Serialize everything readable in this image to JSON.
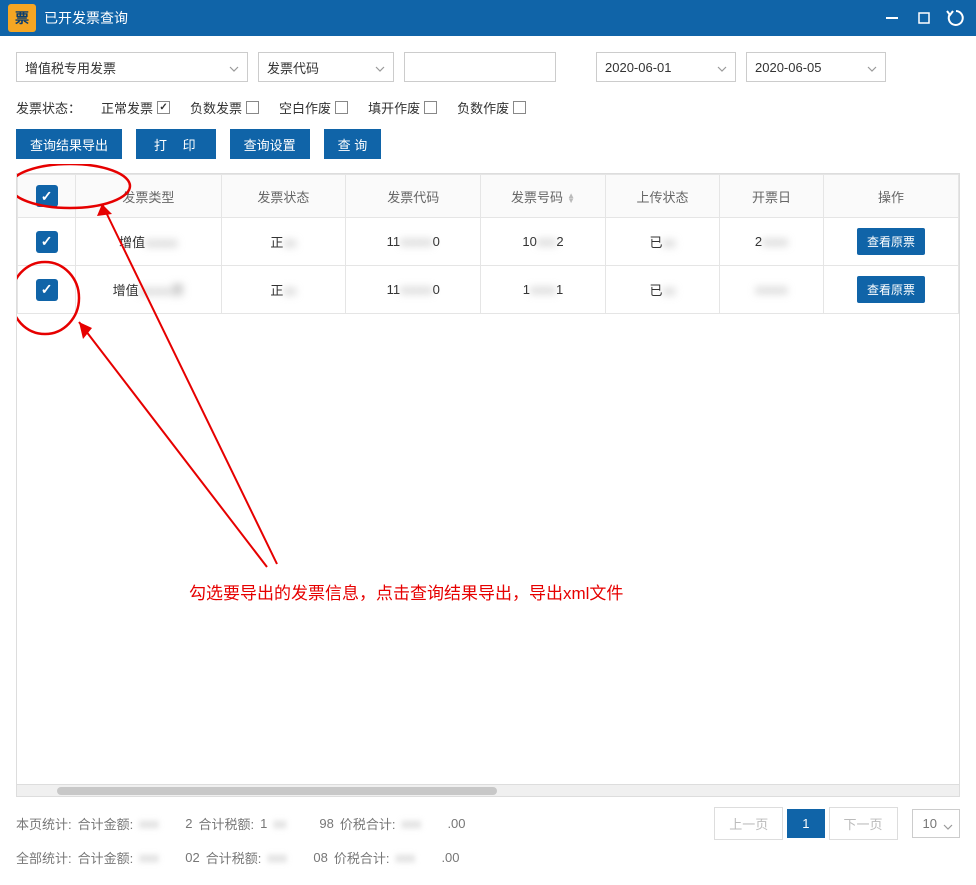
{
  "titlebar": {
    "logo": "票",
    "title": "已开发票查询"
  },
  "filters": {
    "invoice_type": "增值税专用发票",
    "code_field_label": "发票代码",
    "code_value": "",
    "date_from": "2020-06-01",
    "date_to": "2020-06-05"
  },
  "status": {
    "label": "发票状态：",
    "options": {
      "normal": "正常发票",
      "negative": "负数发票",
      "blank_void": "空白作废",
      "fill_void": "填开作废",
      "neg_void": "负数作废"
    }
  },
  "buttons": {
    "export": "查询结果导出",
    "print": "打 印",
    "settings": "查询设置",
    "query": "查  询"
  },
  "table": {
    "headers": {
      "type": "发票类型",
      "status": "发票状态",
      "code": "发票代码",
      "number": "发票号码",
      "upload": "上传状态",
      "date": "开票日",
      "action": "操作"
    },
    "rows": [
      {
        "type_prefix": "增值",
        "type_blur": "xxxxx",
        "status_prefix": "正",
        "status_blur": "xx",
        "code_prefix": "11",
        "code_blur": "xxxxx",
        "code_suffix": "0",
        "num_prefix": "10",
        "num_blur": "xxx",
        "num_suffix": "2",
        "upload_prefix": "已",
        "upload_blur": "xx",
        "date_prefix": "2",
        "date_blur": "xxxx",
        "action": "查看原票"
      },
      {
        "type_prefix": "增值",
        "type_blur": "xxxxx票",
        "status_prefix": "正",
        "status_blur": "xx",
        "code_prefix": "11",
        "code_blur": "xxxxx",
        "code_suffix": "0",
        "num_prefix": "1",
        "num_blur": "xxxx",
        "num_suffix": "1",
        "upload_prefix": "已",
        "upload_blur": "xx",
        "date_prefix": "",
        "date_blur": "xxxxx",
        "action": "查看原票"
      }
    ]
  },
  "annotation": {
    "text": "勾选要导出的发票信息，点击查询结果导出，导出xml文件"
  },
  "footer": {
    "page_stats": {
      "label": "本页统计:",
      "amount_label": "合计金额:",
      "amount_blur": "xxx",
      "amount_suffix": "2",
      "tax_label": "合计税额:",
      "tax_prefix": "1",
      "tax_blur": "xx",
      "tax_suffix": "98",
      "total_label": "价税合计:",
      "total_blur": "xxx",
      "total_suffix": ".00"
    },
    "all_stats": {
      "label": "全部统计:",
      "amount_label": "合计金额:",
      "amount_blur": "xxx",
      "amount_suffix": "02",
      "tax_label": "合计税额:",
      "tax_blur": "xxx",
      "tax_suffix": "08",
      "total_label": "价税合计:",
      "total_blur": "xxx",
      "total_suffix": ".00"
    },
    "pager": {
      "prev": "上一页",
      "current": "1",
      "next": "下一页",
      "size": "10"
    }
  }
}
